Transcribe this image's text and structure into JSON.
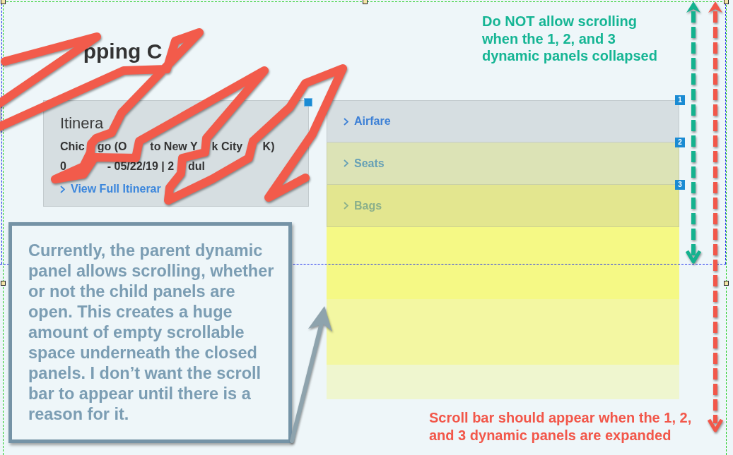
{
  "page_title": {
    "visible_parts": [
      "pping C"
    ]
  },
  "itinerary_card": {
    "title_visible_parts": [
      "Itinera"
    ],
    "route_visible_parts": [
      "Chic",
      "go (O",
      "to New Y",
      "k City",
      "K)"
    ],
    "dates_visible_parts": [
      "0",
      "- 05/22/19 | 2",
      "dul"
    ],
    "link": "View Full Itinerar"
  },
  "dynamic_panels": [
    {
      "badge": "1",
      "label": "Airfare",
      "expanded": false
    },
    {
      "badge": "2",
      "label": "Seats",
      "expanded": false
    },
    {
      "badge": "3",
      "label": "Bags",
      "expanded": false
    }
  ],
  "annotations": {
    "collapsed_note": "Do NOT allow scrolling when the 1, 2, and 3 dynamic panels collapsed",
    "expanded_note": "Scroll bar should appear when the 1, 2, and 3 dynamic panels are expanded",
    "comment": "Currently, the parent dynamic panel allows scrolling, whether or not the child panels are open. This creates a huge amount of empty scrollable space underneath the closed panels. I don’t want the scroll bar to appear until there is a reason for it."
  }
}
